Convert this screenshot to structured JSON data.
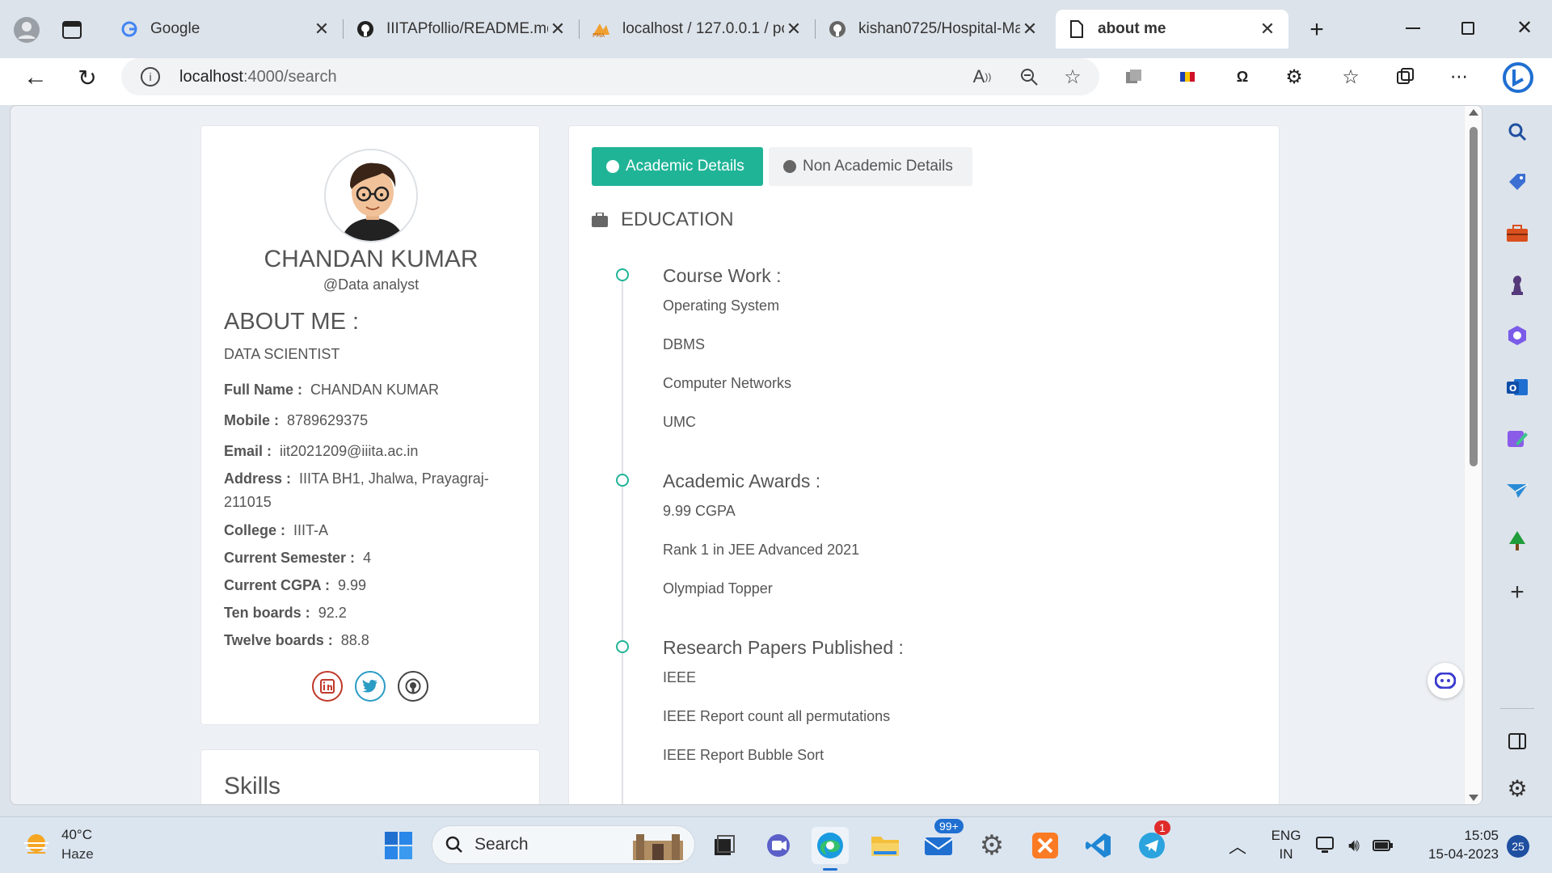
{
  "browser": {
    "tabs": [
      {
        "label": "Google",
        "icon": "google-icon"
      },
      {
        "label": "IIITAPfollio/README.md",
        "icon": "github-icon"
      },
      {
        "label": "localhost / 127.0.0.1 / pc",
        "icon": "phpmyadmin-icon"
      },
      {
        "label": "kishan0725/Hospital-Ma",
        "icon": "github-icon"
      },
      {
        "label": "about me",
        "icon": "page-icon",
        "active": true
      }
    ],
    "address": {
      "host": "localhost",
      "path": ":4000/search"
    }
  },
  "profile": {
    "name": "CHANDAN KUMAR",
    "role": "@Data analyst",
    "about_title": "ABOUT ME :",
    "about_sub": "DATA SCIENTIST",
    "fields": [
      {
        "label": "Full Name :",
        "value": "CHANDAN KUMAR"
      },
      {
        "label": "Mobile :",
        "value": "8789629375"
      },
      {
        "label": "Email :",
        "value": "iit2021209@iiita.ac.in"
      },
      {
        "label": "Address :",
        "value": "IIITA BH1, Jhalwa, Prayagraj-211015"
      },
      {
        "label": "College :",
        "value": "IIIT-A"
      },
      {
        "label": "Current Semester :",
        "value": "4"
      },
      {
        "label": "Current CGPA :",
        "value": "9.99"
      },
      {
        "label": "Ten boards :",
        "value": "92.2"
      },
      {
        "label": "Twelve boards :",
        "value": "88.8"
      }
    ],
    "social": [
      "linkedin-icon",
      "twitter-icon",
      "github-icon"
    ]
  },
  "skills": {
    "title": "Skills"
  },
  "main": {
    "tabs": {
      "academic": "Academic Details",
      "non_academic": "Non Academic Details"
    },
    "section_title": "EDUCATION",
    "timeline": [
      {
        "title": "Course Work :",
        "items": [
          "Operating System",
          "DBMS",
          "Computer Networks",
          "UMC"
        ]
      },
      {
        "title": "Academic Awards :",
        "items": [
          "9.99 CGPA",
          "Rank 1 in JEE Advanced 2021",
          "Olympiad Topper"
        ]
      },
      {
        "title": "Research Papers Published :",
        "items": [
          "IEEE",
          "IEEE Report count all permutations",
          "IEEE Report Bubble Sort"
        ]
      }
    ]
  },
  "taskbar": {
    "weather_temp": "40°C",
    "weather_desc": "Haze",
    "search_label": "Search",
    "mail_badge": "99+",
    "telegram_badge": "1",
    "lang_top": "ENG",
    "lang_bottom": "IN",
    "time": "15:05",
    "date": "15-04-2023",
    "notif_count": "25"
  },
  "colors": {
    "accent": "#20b497",
    "linkedin": "#c0392b",
    "twitter": "#2b9cc4",
    "github": "#444444"
  }
}
